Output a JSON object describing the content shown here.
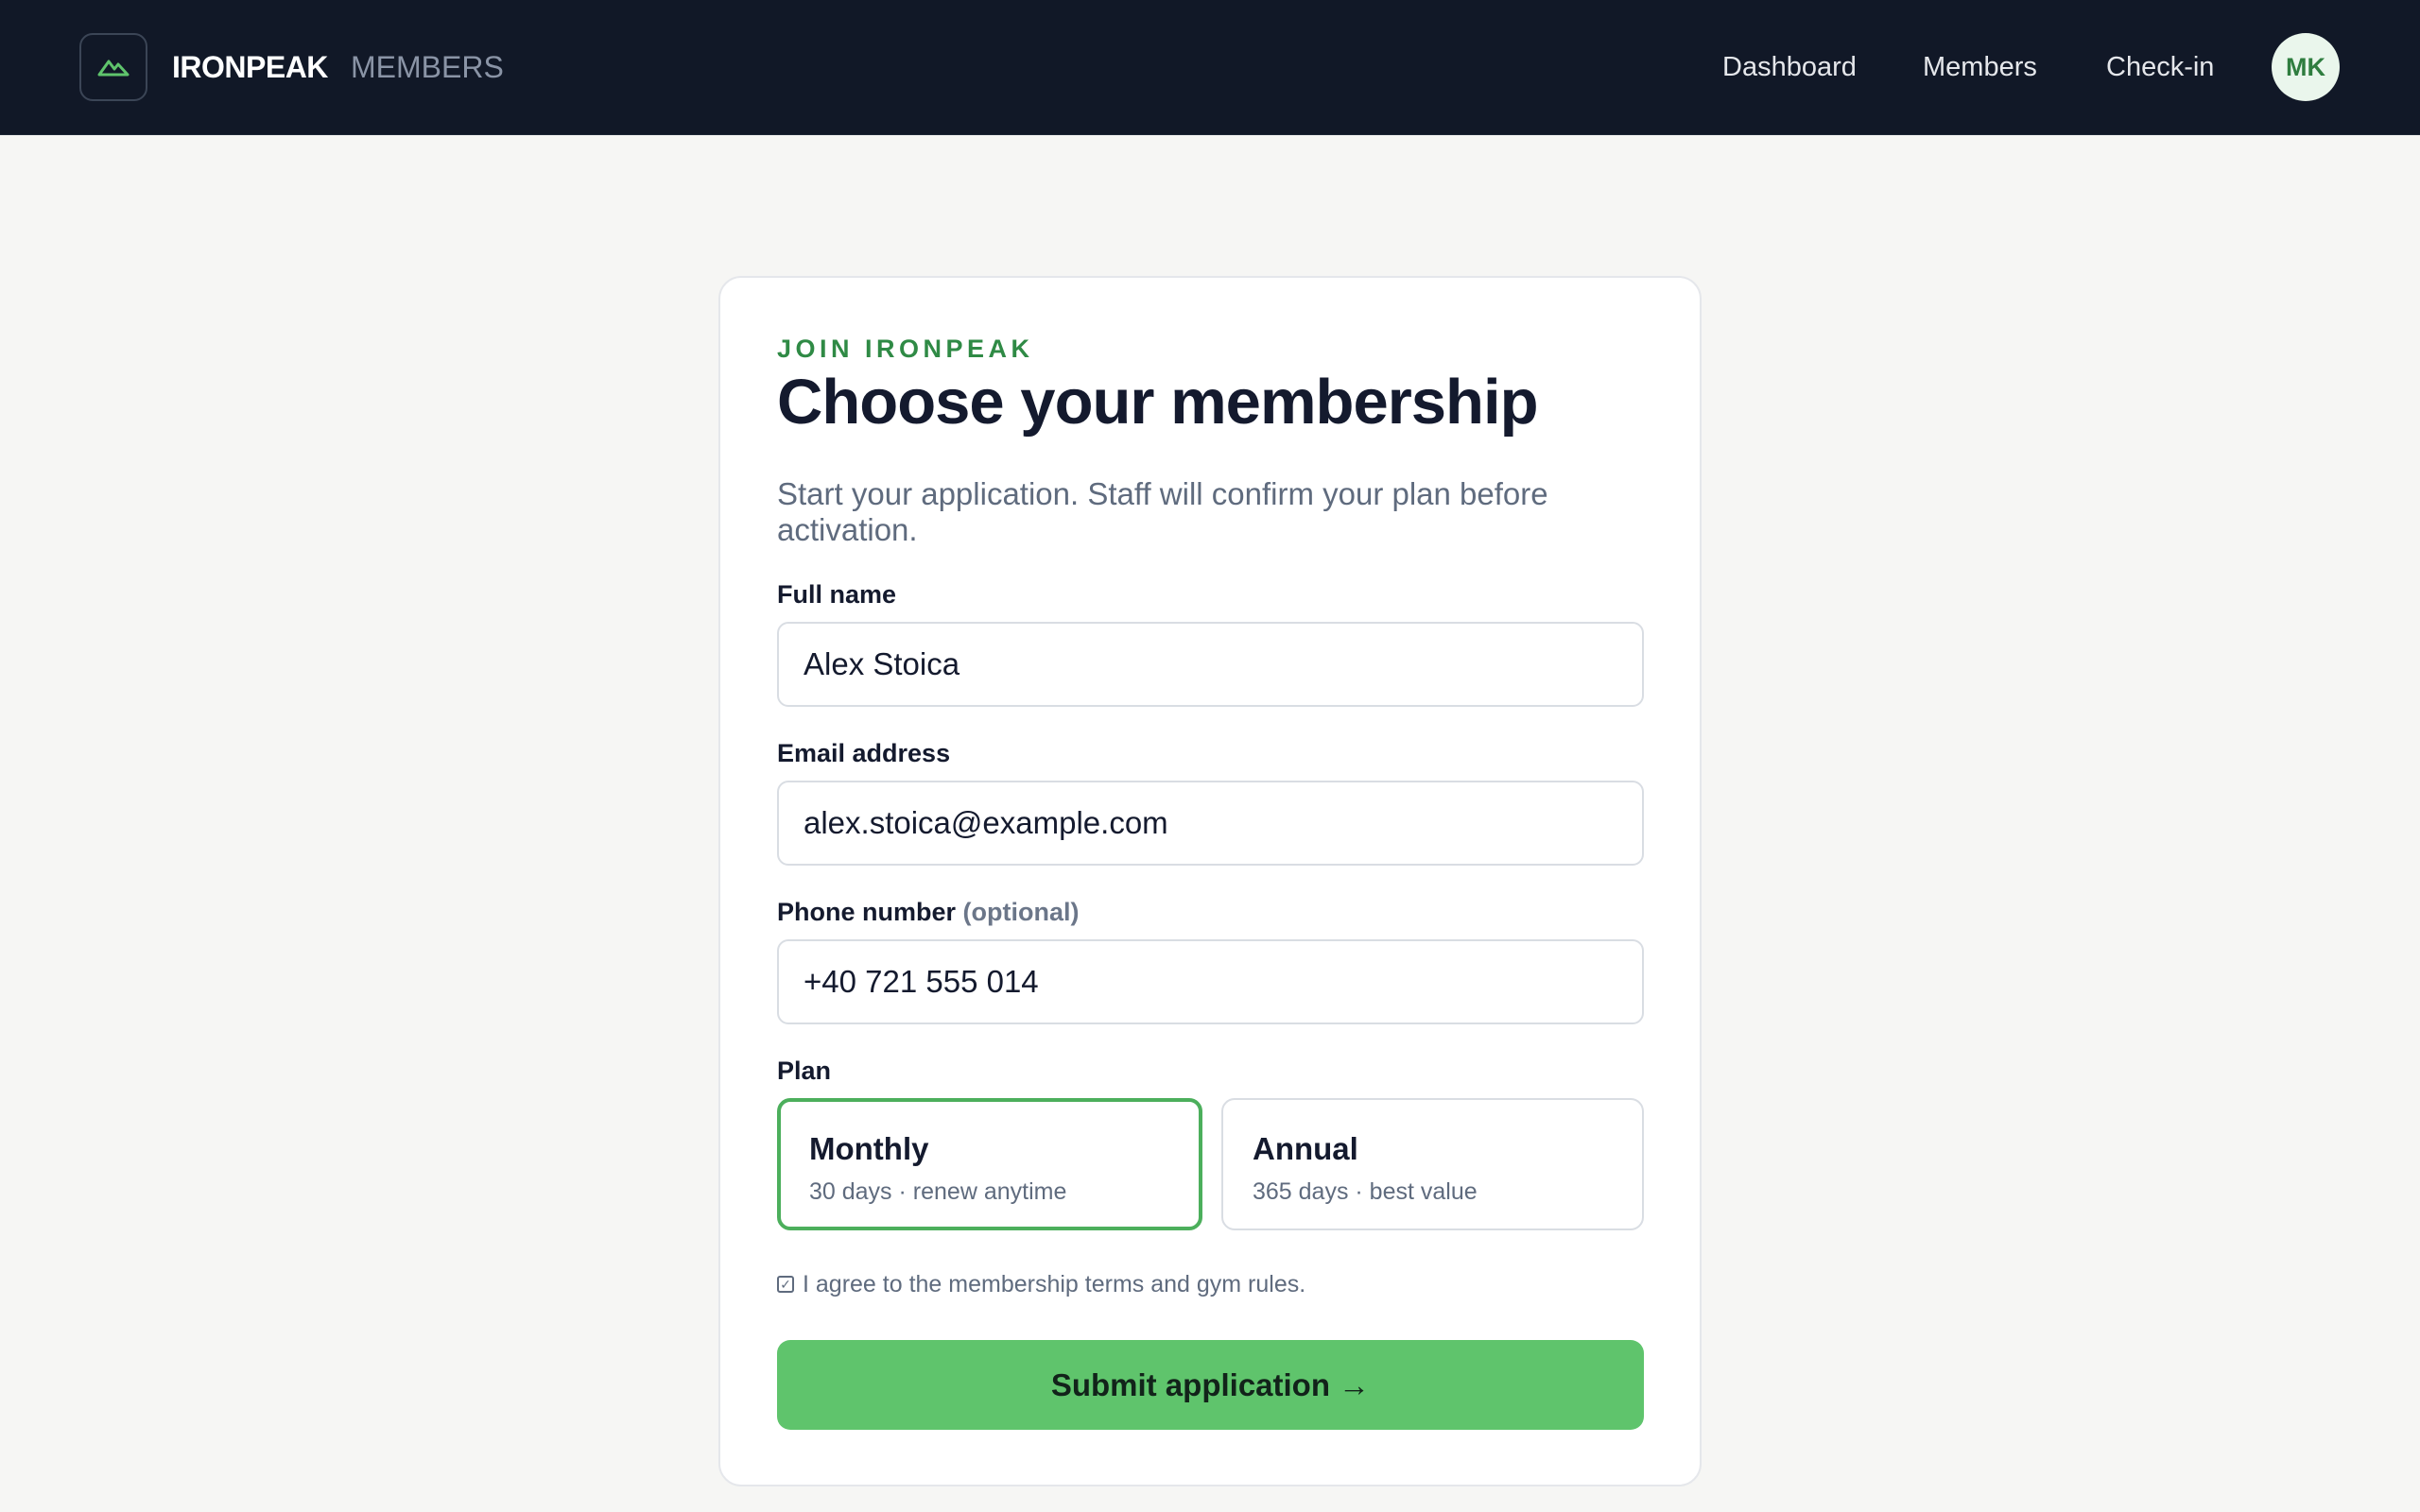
{
  "header": {
    "brand": "IRONPEAK",
    "brand_sub": "MEMBERS",
    "logo_icon": "mountain-icon",
    "nav": [
      {
        "label": "Dashboard"
      },
      {
        "label": "Members"
      },
      {
        "label": "Check-in"
      }
    ],
    "avatar_initials": "MK"
  },
  "form": {
    "eyebrow": "JOIN IRONPEAK",
    "title": "Choose your membership",
    "lede": "Start your application. Staff will confirm your plan before activation.",
    "full_name": {
      "label": "Full name",
      "value": "Alex Stoica"
    },
    "email": {
      "label": "Email address",
      "value": "alex.stoica@example.com"
    },
    "phone": {
      "label": "Phone number",
      "optional": "(optional)",
      "value": "+40 721 555 014"
    },
    "plan": {
      "label": "Plan",
      "selected": "Monthly",
      "options": [
        {
          "name": "Monthly",
          "desc": "30 days · renew anytime"
        },
        {
          "name": "Annual",
          "desc": "365 days · best value"
        }
      ]
    },
    "agree_text": "I agree to the membership terms and gym rules.",
    "agree_checked": true,
    "submit_label": "Submit application →"
  },
  "colors": {
    "topbar": "#111827",
    "accent": "#5fc46c",
    "accent_text": "#2f8a45",
    "selected_border": "#4caf5c",
    "background": "#f6f6f4"
  }
}
